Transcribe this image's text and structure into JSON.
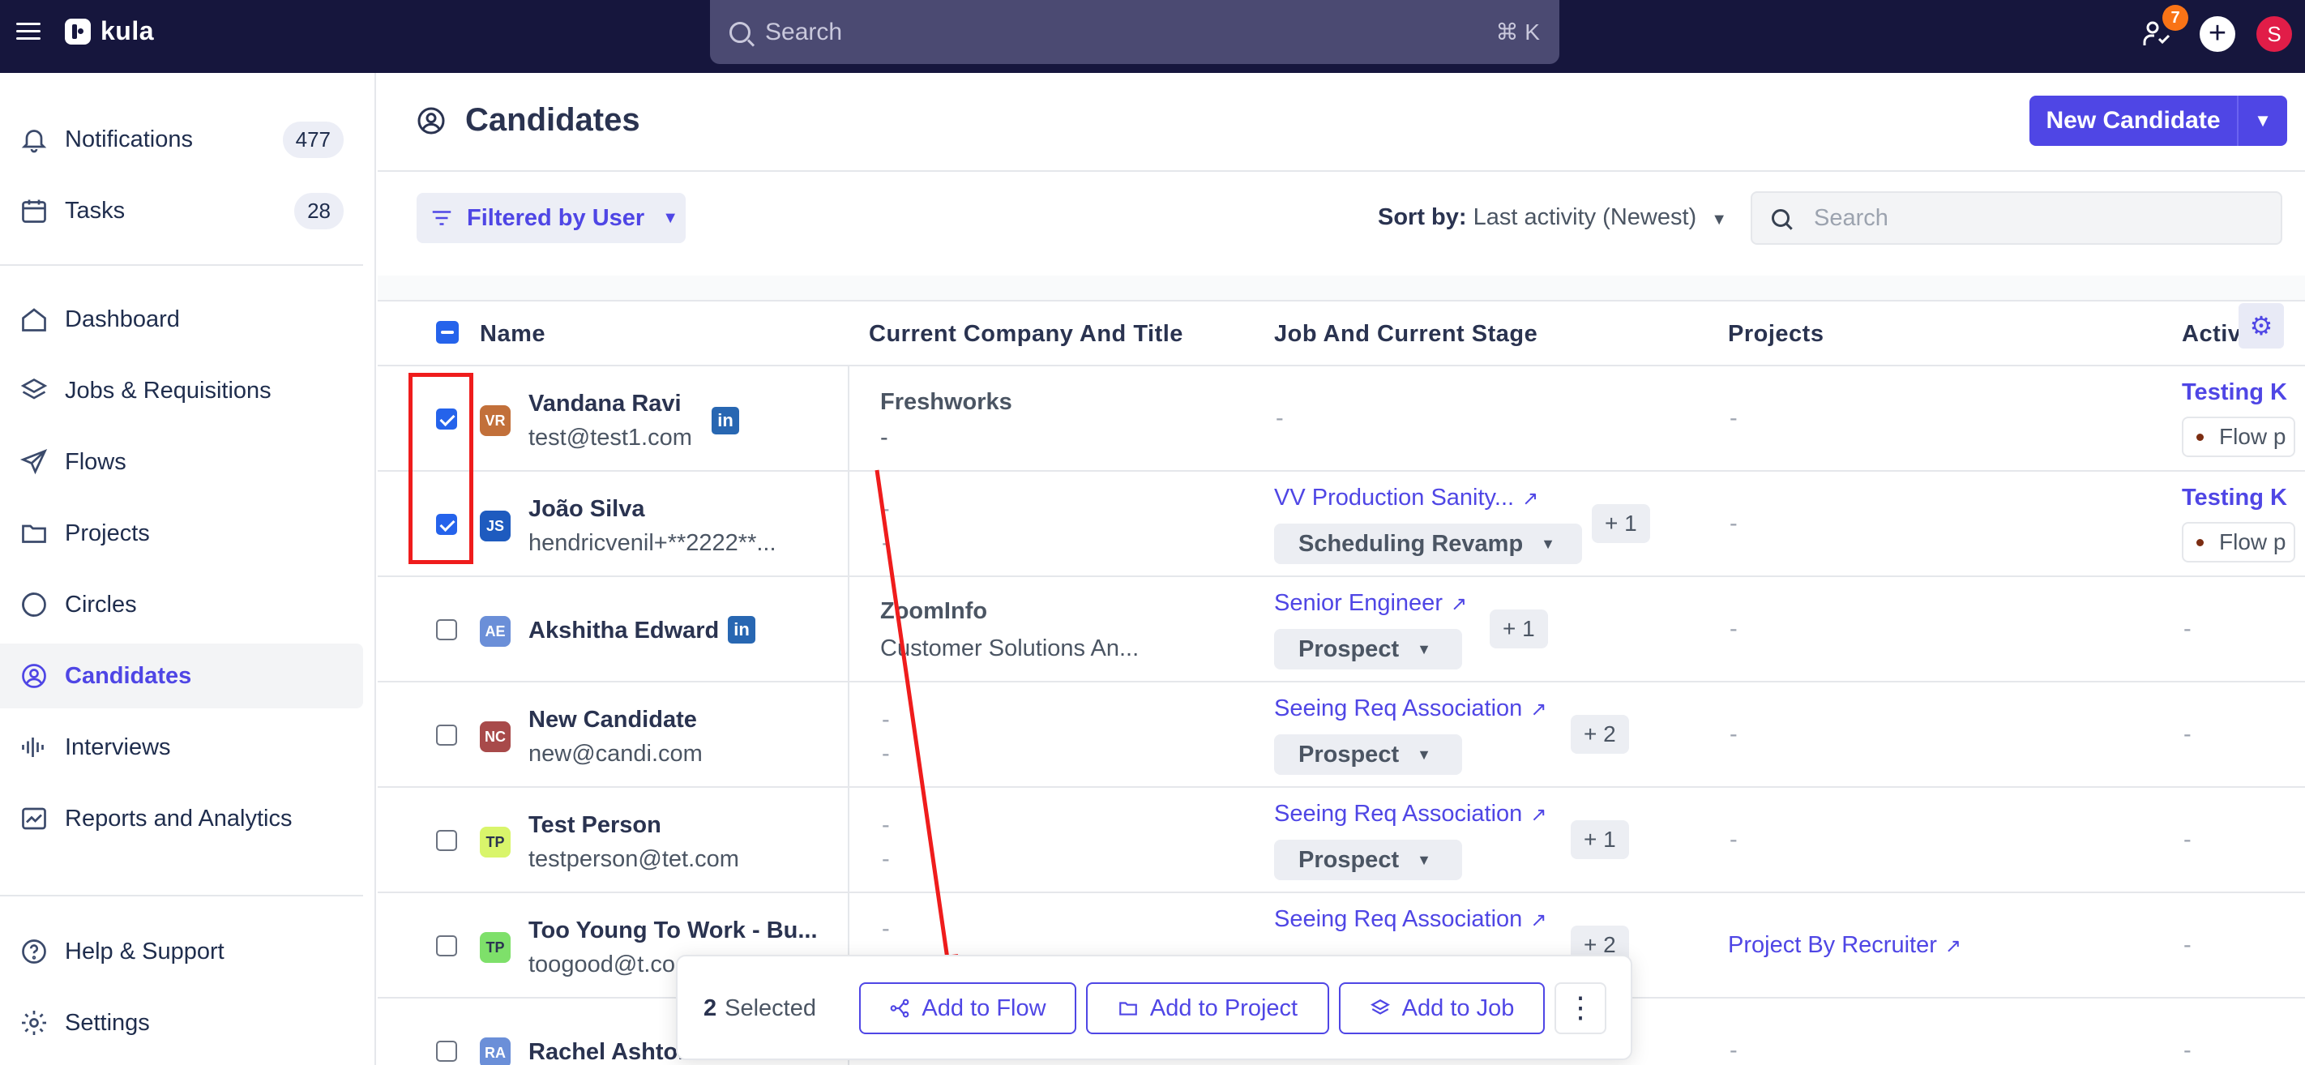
{
  "topbar": {
    "logo_text": "kula",
    "search_placeholder": "Search",
    "shortcut": "⌘ K",
    "notif_badge": "7",
    "avatar_initial": "S"
  },
  "sidebar": {
    "items": [
      {
        "label": "Notifications",
        "count": "477",
        "icon": "bell-icon"
      },
      {
        "label": "Tasks",
        "count": "28",
        "icon": "calendar-icon"
      },
      {
        "label": "Dashboard",
        "icon": "home-icon"
      },
      {
        "label": "Jobs & Requisitions",
        "icon": "layers-icon"
      },
      {
        "label": "Flows",
        "icon": "send-icon"
      },
      {
        "label": "Projects",
        "icon": "folder-icon"
      },
      {
        "label": "Circles",
        "icon": "circles-icon"
      },
      {
        "label": "Candidates",
        "icon": "user-circle-icon",
        "active": true
      },
      {
        "label": "Interviews",
        "icon": "audio-bars-icon"
      },
      {
        "label": "Reports and Analytics",
        "icon": "chart-icon"
      },
      {
        "label": "Help & Support",
        "icon": "help-icon"
      },
      {
        "label": "Settings",
        "icon": "gear-icon"
      }
    ]
  },
  "header": {
    "title": "Candidates",
    "new_button": "New Candidate"
  },
  "filters": {
    "filter_label": "Filtered by User",
    "sort_label": "Sort by:",
    "sort_value": "Last activity (Newest)",
    "search_placeholder": "Search"
  },
  "table": {
    "columns": [
      "Name",
      "Current Company And Title",
      "Job And Current Stage",
      "Projects",
      "Activ"
    ],
    "rows": [
      {
        "initials": "VR",
        "avatar_color": "#c2703a",
        "name": "Vandana Ravi",
        "email": "test@test1.com",
        "linkedin": true,
        "checked": true,
        "company": "Freshworks",
        "title": "-",
        "job": "-",
        "stage": "",
        "plus": "",
        "project": "-",
        "activity": "Testing K",
        "activity_tag": "Flow p"
      },
      {
        "initials": "JS",
        "avatar_color": "#1e5bbf",
        "name": "João Silva",
        "email": "hendricvenil+**2222**...",
        "linkedin": false,
        "checked": true,
        "company": "-",
        "title": "-",
        "job": "VV Production Sanity...",
        "stage": "Scheduling Revamp",
        "plus": "+ 1",
        "project": "-",
        "activity": "Testing K",
        "activity_tag": "Flow p"
      },
      {
        "initials": "AE",
        "avatar_color": "#6b8fd8",
        "name": "Akshitha Edward",
        "email": "",
        "linkedin": true,
        "checked": false,
        "company": "ZoomInfo",
        "title": "Customer Solutions An...",
        "job": "Senior Engineer",
        "stage": "Prospect",
        "plus": "+ 1",
        "project": "-",
        "activity": "-"
      },
      {
        "initials": "NC",
        "avatar_color": "#a84a4a",
        "name": "New Candidate",
        "email": "new@candi.com",
        "linkedin": false,
        "checked": false,
        "company": "-",
        "title": "-",
        "job": "Seeing Req Association",
        "stage": "Prospect",
        "plus": "+ 2",
        "project": "-",
        "activity": "-"
      },
      {
        "initials": "TP",
        "avatar_color": "#d9f56b",
        "name": "Test Person",
        "email": "testperson@tet.com",
        "linkedin": false,
        "checked": false,
        "company": "-",
        "title": "-",
        "job": "Seeing Req Association",
        "stage": "Prospect",
        "plus": "+ 1",
        "project": "-",
        "activity": "-"
      },
      {
        "initials": "TP",
        "avatar_color": "#7ee06a",
        "name": "Too Young To Work - Bu...",
        "email": "toogood@t.co",
        "linkedin": false,
        "checked": false,
        "company": "-",
        "title": "",
        "job": "Seeing Req Association",
        "stage": "",
        "plus": "+ 2",
        "project": "Project By Recruiter",
        "activity": "-"
      },
      {
        "initials": "RA",
        "avatar_color": "#6b8fd8",
        "name": "Rachel Ashton",
        "email": "",
        "linkedin": false,
        "checked": false,
        "company": "",
        "title": "",
        "job": "",
        "stage": "",
        "plus": "",
        "project": "-",
        "activity": "-"
      }
    ]
  },
  "action_bar": {
    "count": "2",
    "selected_label": "Selected",
    "add_to_flow": "Add to Flow",
    "add_to_project": "Add to Project",
    "add_to_job": "Add to Job"
  },
  "colors": {
    "accent": "#4f46e5",
    "topbar": "#16163d",
    "annotation": "#ef1c1c"
  }
}
